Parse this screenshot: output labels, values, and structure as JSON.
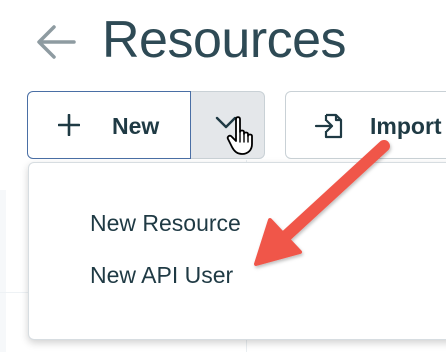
{
  "header": {
    "title": "Resources",
    "back_icon": "arrow-left-icon"
  },
  "toolbar": {
    "new_label": "New",
    "new_icon": "plus-icon",
    "dropdown_icon": "chevron-down-icon",
    "import_label": "Import",
    "import_icon": "import-icon"
  },
  "dropdown": {
    "items": [
      {
        "label": "New Resource"
      },
      {
        "label": "New API User"
      }
    ]
  },
  "cursor": "hand-pointer-icon",
  "annotation": {
    "type": "arrow",
    "color": "#f0564a",
    "points_to": "New API User"
  },
  "colors": {
    "title": "#2e4a55",
    "text": "#1f3a44",
    "primary_border": "#4a6fa5",
    "toggle_bg": "#e4e7ea",
    "border": "#c9d1d6"
  }
}
